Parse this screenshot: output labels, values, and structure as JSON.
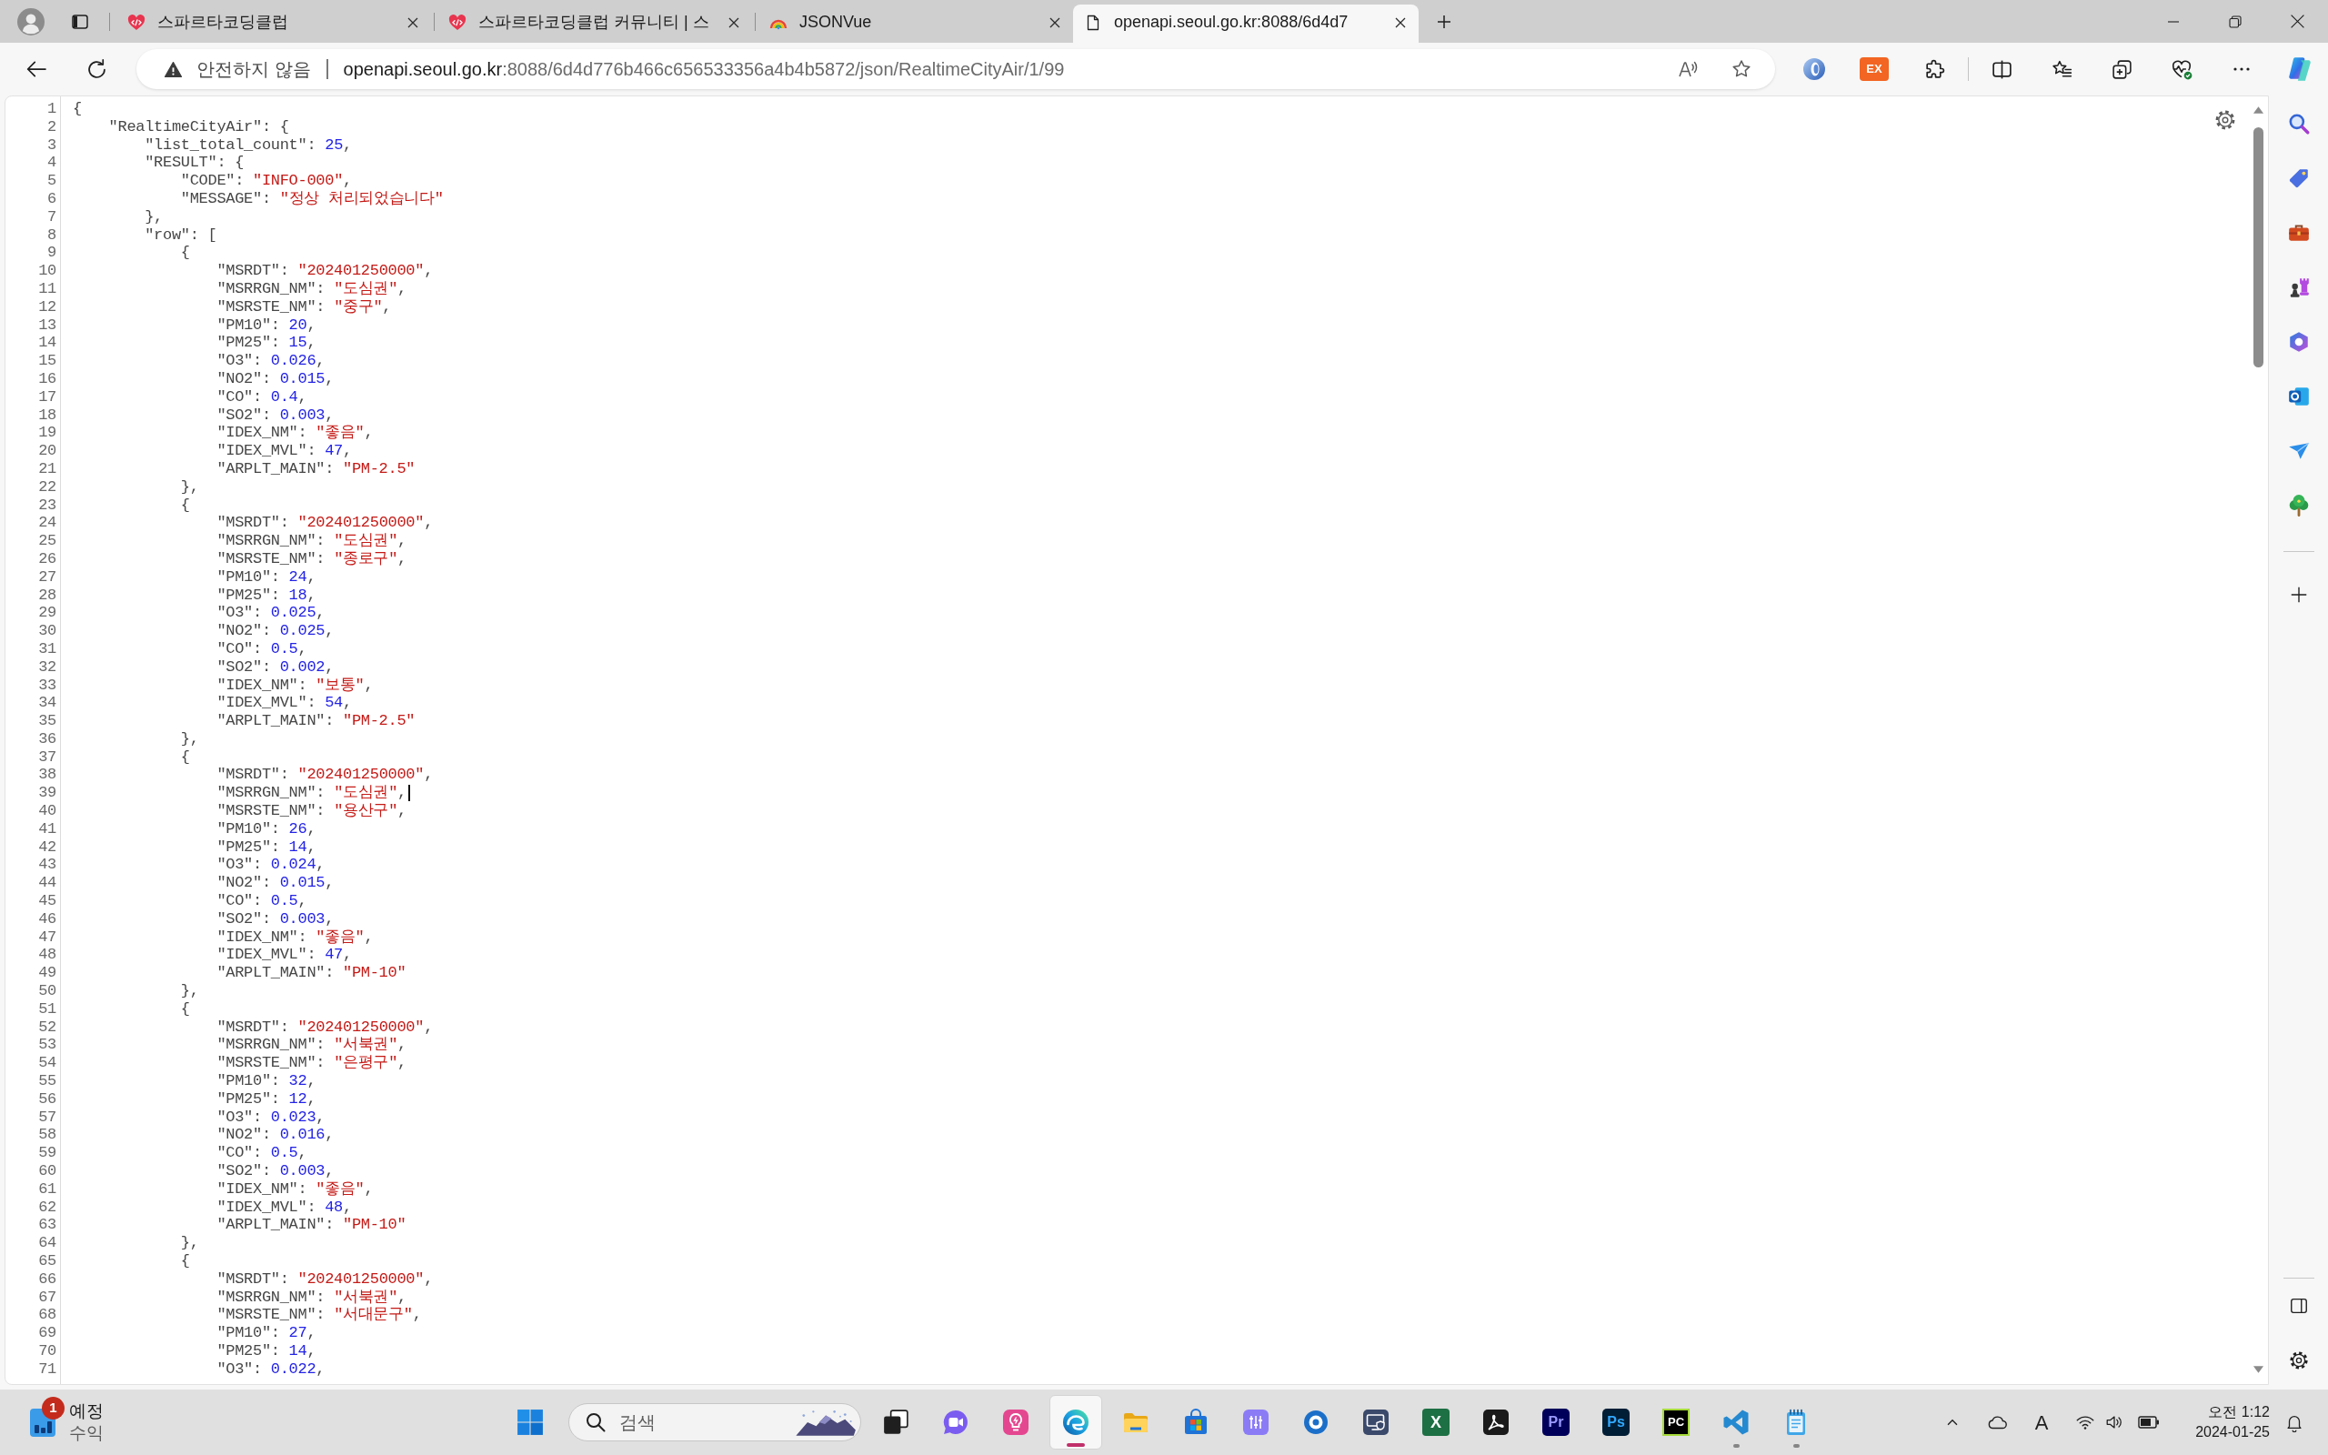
{
  "tabs": [
    {
      "kind": "site",
      "title": "스파르타코딩클럽",
      "selected": false
    },
    {
      "kind": "site",
      "title": "스파르타코딩클럽 커뮤니티 | 스",
      "selected": false
    },
    {
      "kind": "extension",
      "title": "JSONVue",
      "selected": false
    },
    {
      "kind": "page",
      "title": "openapi.seoul.go.kr:8088/6d4d7",
      "selected": true
    }
  ],
  "address_bar": {
    "security_label": "안전하지 않음",
    "url_host": "openapi.seoul.go.kr",
    "url_path": ":8088/6d4d776b466c656533356a4b4b5872/json/RealtimeCityAir/1/99"
  },
  "toolbar": {
    "extension_label": "EX"
  },
  "json_viewer": {
    "lines": [
      {
        "number": "1",
        "tokens": [
          {
            "kind": "plain",
            "text": "{"
          }
        ],
        "children": [
          {
            "number": "2",
            "tokens": [
              {
                "kind": "plain",
                "text": "\"RealtimeCityAir\": {"
              }
            ],
            "children": [
              {
                "number": "3",
                "tokens": [
                  {
                    "kind": "plain",
                    "text": "\"list_total_count\": "
                  },
                  {
                    "kind": "number",
                    "text": "25"
                  },
                  {
                    "kind": "plain",
                    "text": ","
                  }
                ]
              },
              {
                "number": "4",
                "tokens": [
                  {
                    "kind": "plain",
                    "text": "\"RESULT\": {"
                  }
                ],
                "children": [
                  {
                    "number": "5",
                    "tokens": [
                      {
                        "kind": "plain",
                        "text": "\"CODE\": "
                      },
                      {
                        "kind": "string",
                        "text": "\"INFO-000\""
                      },
                      {
                        "kind": "plain",
                        "text": ","
                      }
                    ]
                  },
                  {
                    "number": "6",
                    "tokens": [
                      {
                        "kind": "plain",
                        "text": "\"MESSAGE\": "
                      },
                      {
                        "kind": "string",
                        "text": "\"정상 처리되었습니다\""
                      }
                    ]
                  }
                ]
              },
              {
                "number": "7",
                "tokens": [
                  {
                    "kind": "plain",
                    "text": "},"
                  }
                ]
              },
              {
                "number": "8",
                "tokens": [
                  {
                    "kind": "plain",
                    "text": "\"row\": ["
                  }
                ],
                "children": [
                  {
                    "number": "9",
                    "tokens": [
                      {
                        "kind": "plain",
                        "text": "{"
                      }
                    ],
                    "children": [
                      {
                        "number": "10",
                        "tokens": [
                          {
                            "kind": "plain",
                            "text": "\"MSRDT\": "
                          },
                          {
                            "kind": "string",
                            "text": "\"202401250000\""
                          },
                          {
                            "kind": "plain",
                            "text": ","
                          }
                        ]
                      },
                      {
                        "number": "11",
                        "tokens": [
                          {
                            "kind": "plain",
                            "text": "\"MSRRGN_NM\": "
                          },
                          {
                            "kind": "string",
                            "text": "\"도심권\""
                          },
                          {
                            "kind": "plain",
                            "text": ","
                          }
                        ]
                      },
                      {
                        "number": "12",
                        "tokens": [
                          {
                            "kind": "plain",
                            "text": "\"MSRSTE_NM\": "
                          },
                          {
                            "kind": "string",
                            "text": "\"중구\""
                          },
                          {
                            "kind": "plain",
                            "text": ","
                          }
                        ]
                      },
                      {
                        "number": "13",
                        "tokens": [
                          {
                            "kind": "plain",
                            "text": "\"PM10\": "
                          },
                          {
                            "kind": "number",
                            "text": "20"
                          },
                          {
                            "kind": "plain",
                            "text": ","
                          }
                        ]
                      },
                      {
                        "number": "14",
                        "tokens": [
                          {
                            "kind": "plain",
                            "text": "\"PM25\": "
                          },
                          {
                            "kind": "number",
                            "text": "15"
                          },
                          {
                            "kind": "plain",
                            "text": ","
                          }
                        ]
                      },
                      {
                        "number": "15",
                        "tokens": [
                          {
                            "kind": "plain",
                            "text": "\"O3\": "
                          },
                          {
                            "kind": "number",
                            "text": "0.026"
                          },
                          {
                            "kind": "plain",
                            "text": ","
                          }
                        ]
                      },
                      {
                        "number": "16",
                        "tokens": [
                          {
                            "kind": "plain",
                            "text": "\"NO2\": "
                          },
                          {
                            "kind": "number",
                            "text": "0.015"
                          },
                          {
                            "kind": "plain",
                            "text": ","
                          }
                        ]
                      },
                      {
                        "number": "17",
                        "tokens": [
                          {
                            "kind": "plain",
                            "text": "\"CO\": "
                          },
                          {
                            "kind": "number",
                            "text": "0.4"
                          },
                          {
                            "kind": "plain",
                            "text": ","
                          }
                        ]
                      },
                      {
                        "number": "18",
                        "tokens": [
                          {
                            "kind": "plain",
                            "text": "\"SO2\": "
                          },
                          {
                            "kind": "number",
                            "text": "0.003"
                          },
                          {
                            "kind": "plain",
                            "text": ","
                          }
                        ]
                      },
                      {
                        "number": "19",
                        "tokens": [
                          {
                            "kind": "plain",
                            "text": "\"IDEX_NM\": "
                          },
                          {
                            "kind": "string",
                            "text": "\"좋음\""
                          },
                          {
                            "kind": "plain",
                            "text": ","
                          }
                        ]
                      },
                      {
                        "number": "20",
                        "tokens": [
                          {
                            "kind": "plain",
                            "text": "\"IDEX_MVL\": "
                          },
                          {
                            "kind": "number",
                            "text": "47"
                          },
                          {
                            "kind": "plain",
                            "text": ","
                          }
                        ]
                      },
                      {
                        "number": "21",
                        "tokens": [
                          {
                            "kind": "plain",
                            "text": "\"ARPLT_MAIN\": "
                          },
                          {
                            "kind": "string",
                            "text": "\"PM-2.5\""
                          }
                        ]
                      }
                    ]
                  },
                  {
                    "number": "22",
                    "tokens": [
                      {
                        "kind": "plain",
                        "text": "},"
                      }
                    ]
                  },
                  {
                    "number": "23",
                    "tokens": [
                      {
                        "kind": "plain",
                        "text": "{"
                      }
                    ],
                    "children": [
                      {
                        "number": "24",
                        "tokens": [
                          {
                            "kind": "plain",
                            "text": "\"MSRDT\": "
                          },
                          {
                            "kind": "string",
                            "text": "\"202401250000\""
                          },
                          {
                            "kind": "plain",
                            "text": ","
                          }
                        ]
                      },
                      {
                        "number": "25",
                        "tokens": [
                          {
                            "kind": "plain",
                            "text": "\"MSRRGN_NM\": "
                          },
                          {
                            "kind": "string",
                            "text": "\"도심권\""
                          },
                          {
                            "kind": "plain",
                            "text": ","
                          }
                        ]
                      },
                      {
                        "number": "26",
                        "tokens": [
                          {
                            "kind": "plain",
                            "text": "\"MSRSTE_NM\": "
                          },
                          {
                            "kind": "string",
                            "text": "\"종로구\""
                          },
                          {
                            "kind": "plain",
                            "text": ","
                          }
                        ]
                      },
                      {
                        "number": "27",
                        "tokens": [
                          {
                            "kind": "plain",
                            "text": "\"PM10\": "
                          },
                          {
                            "kind": "number",
                            "text": "24"
                          },
                          {
                            "kind": "plain",
                            "text": ","
                          }
                        ]
                      },
                      {
                        "number": "28",
                        "tokens": [
                          {
                            "kind": "plain",
                            "text": "\"PM25\": "
                          },
                          {
                            "kind": "number",
                            "text": "18"
                          },
                          {
                            "kind": "plain",
                            "text": ","
                          }
                        ]
                      },
                      {
                        "number": "29",
                        "tokens": [
                          {
                            "kind": "plain",
                            "text": "\"O3\": "
                          },
                          {
                            "kind": "number",
                            "text": "0.025"
                          },
                          {
                            "kind": "plain",
                            "text": ","
                          }
                        ]
                      },
                      {
                        "number": "30",
                        "tokens": [
                          {
                            "kind": "plain",
                            "text": "\"NO2\": "
                          },
                          {
                            "kind": "number",
                            "text": "0.025"
                          },
                          {
                            "kind": "plain",
                            "text": ","
                          }
                        ]
                      },
                      {
                        "number": "31",
                        "tokens": [
                          {
                            "kind": "plain",
                            "text": "\"CO\": "
                          },
                          {
                            "kind": "number",
                            "text": "0.5"
                          },
                          {
                            "kind": "plain",
                            "text": ","
                          }
                        ]
                      },
                      {
                        "number": "32",
                        "tokens": [
                          {
                            "kind": "plain",
                            "text": "\"SO2\": "
                          },
                          {
                            "kind": "number",
                            "text": "0.002"
                          },
                          {
                            "kind": "plain",
                            "text": ","
                          }
                        ]
                      },
                      {
                        "number": "33",
                        "tokens": [
                          {
                            "kind": "plain",
                            "text": "\"IDEX_NM\": "
                          },
                          {
                            "kind": "string",
                            "text": "\"보통\""
                          },
                          {
                            "kind": "plain",
                            "text": ","
                          }
                        ]
                      },
                      {
                        "number": "34",
                        "tokens": [
                          {
                            "kind": "plain",
                            "text": "\"IDEX_MVL\": "
                          },
                          {
                            "kind": "number",
                            "text": "54"
                          },
                          {
                            "kind": "plain",
                            "text": ","
                          }
                        ]
                      },
                      {
                        "number": "35",
                        "tokens": [
                          {
                            "kind": "plain",
                            "text": "\"ARPLT_MAIN\": "
                          },
                          {
                            "kind": "string",
                            "text": "\"PM-2.5\""
                          }
                        ]
                      }
                    ]
                  },
                  {
                    "number": "36",
                    "tokens": [
                      {
                        "kind": "plain",
                        "text": "},"
                      }
                    ]
                  },
                  {
                    "number": "37",
                    "tokens": [
                      {
                        "kind": "plain",
                        "text": "{"
                      }
                    ],
                    "children": [
                      {
                        "number": "38",
                        "tokens": [
                          {
                            "kind": "plain",
                            "text": "\"MSRDT\": "
                          },
                          {
                            "kind": "string",
                            "text": "\"202401250000\""
                          },
                          {
                            "kind": "plain",
                            "text": ","
                          }
                        ]
                      },
                      {
                        "number": "39",
                        "caret": true,
                        "tokens": [
                          {
                            "kind": "plain",
                            "text": "\"MSRRGN_NM\": "
                          },
                          {
                            "kind": "string",
                            "text": "\"도심권\""
                          },
                          {
                            "kind": "plain",
                            "text": ","
                          }
                        ]
                      },
                      {
                        "number": "40",
                        "tokens": [
                          {
                            "kind": "plain",
                            "text": "\"MSRSTE_NM\": "
                          },
                          {
                            "kind": "string",
                            "text": "\"용산구\""
                          },
                          {
                            "kind": "plain",
                            "text": ","
                          }
                        ]
                      },
                      {
                        "number": "41",
                        "tokens": [
                          {
                            "kind": "plain",
                            "text": "\"PM10\": "
                          },
                          {
                            "kind": "number",
                            "text": "26"
                          },
                          {
                            "kind": "plain",
                            "text": ","
                          }
                        ]
                      },
                      {
                        "number": "42",
                        "tokens": [
                          {
                            "kind": "plain",
                            "text": "\"PM25\": "
                          },
                          {
                            "kind": "number",
                            "text": "14"
                          },
                          {
                            "kind": "plain",
                            "text": ","
                          }
                        ]
                      },
                      {
                        "number": "43",
                        "tokens": [
                          {
                            "kind": "plain",
                            "text": "\"O3\": "
                          },
                          {
                            "kind": "number",
                            "text": "0.024"
                          },
                          {
                            "kind": "plain",
                            "text": ","
                          }
                        ]
                      },
                      {
                        "number": "44",
                        "tokens": [
                          {
                            "kind": "plain",
                            "text": "\"NO2\": "
                          },
                          {
                            "kind": "number",
                            "text": "0.015"
                          },
                          {
                            "kind": "plain",
                            "text": ","
                          }
                        ]
                      },
                      {
                        "number": "45",
                        "tokens": [
                          {
                            "kind": "plain",
                            "text": "\"CO\": "
                          },
                          {
                            "kind": "number",
                            "text": "0.5"
                          },
                          {
                            "kind": "plain",
                            "text": ","
                          }
                        ]
                      },
                      {
                        "number": "46",
                        "tokens": [
                          {
                            "kind": "plain",
                            "text": "\"SO2\": "
                          },
                          {
                            "kind": "number",
                            "text": "0.003"
                          },
                          {
                            "kind": "plain",
                            "text": ","
                          }
                        ]
                      },
                      {
                        "number": "47",
                        "tokens": [
                          {
                            "kind": "plain",
                            "text": "\"IDEX_NM\": "
                          },
                          {
                            "kind": "string",
                            "text": "\"좋음\""
                          },
                          {
                            "kind": "plain",
                            "text": ","
                          }
                        ]
                      },
                      {
                        "number": "48",
                        "tokens": [
                          {
                            "kind": "plain",
                            "text": "\"IDEX_MVL\": "
                          },
                          {
                            "kind": "number",
                            "text": "47"
                          },
                          {
                            "kind": "plain",
                            "text": ","
                          }
                        ]
                      },
                      {
                        "number": "49",
                        "tokens": [
                          {
                            "kind": "plain",
                            "text": "\"ARPLT_MAIN\": "
                          },
                          {
                            "kind": "string",
                            "text": "\"PM-10\""
                          }
                        ]
                      }
                    ]
                  },
                  {
                    "number": "50",
                    "tokens": [
                      {
                        "kind": "plain",
                        "text": "},"
                      }
                    ]
                  },
                  {
                    "number": "51",
                    "tokens": [
                      {
                        "kind": "plain",
                        "text": "{"
                      }
                    ],
                    "children": [
                      {
                        "number": "52",
                        "tokens": [
                          {
                            "kind": "plain",
                            "text": "\"MSRDT\": "
                          },
                          {
                            "kind": "string",
                            "text": "\"202401250000\""
                          },
                          {
                            "kind": "plain",
                            "text": ","
                          }
                        ]
                      },
                      {
                        "number": "53",
                        "tokens": [
                          {
                            "kind": "plain",
                            "text": "\"MSRRGN_NM\": "
                          },
                          {
                            "kind": "string",
                            "text": "\"서북권\""
                          },
                          {
                            "kind": "plain",
                            "text": ","
                          }
                        ]
                      },
                      {
                        "number": "54",
                        "tokens": [
                          {
                            "kind": "plain",
                            "text": "\"MSRSTE_NM\": "
                          },
                          {
                            "kind": "string",
                            "text": "\"은평구\""
                          },
                          {
                            "kind": "plain",
                            "text": ","
                          }
                        ]
                      },
                      {
                        "number": "55",
                        "tokens": [
                          {
                            "kind": "plain",
                            "text": "\"PM10\": "
                          },
                          {
                            "kind": "number",
                            "text": "32"
                          },
                          {
                            "kind": "plain",
                            "text": ","
                          }
                        ]
                      },
                      {
                        "number": "56",
                        "tokens": [
                          {
                            "kind": "plain",
                            "text": "\"PM25\": "
                          },
                          {
                            "kind": "number",
                            "text": "12"
                          },
                          {
                            "kind": "plain",
                            "text": ","
                          }
                        ]
                      },
                      {
                        "number": "57",
                        "tokens": [
                          {
                            "kind": "plain",
                            "text": "\"O3\": "
                          },
                          {
                            "kind": "number",
                            "text": "0.023"
                          },
                          {
                            "kind": "plain",
                            "text": ","
                          }
                        ]
                      },
                      {
                        "number": "58",
                        "tokens": [
                          {
                            "kind": "plain",
                            "text": "\"NO2\": "
                          },
                          {
                            "kind": "number",
                            "text": "0.016"
                          },
                          {
                            "kind": "plain",
                            "text": ","
                          }
                        ]
                      },
                      {
                        "number": "59",
                        "tokens": [
                          {
                            "kind": "plain",
                            "text": "\"CO\": "
                          },
                          {
                            "kind": "number",
                            "text": "0.5"
                          },
                          {
                            "kind": "plain",
                            "text": ","
                          }
                        ]
                      },
                      {
                        "number": "60",
                        "tokens": [
                          {
                            "kind": "plain",
                            "text": "\"SO2\": "
                          },
                          {
                            "kind": "number",
                            "text": "0.003"
                          },
                          {
                            "kind": "plain",
                            "text": ","
                          }
                        ]
                      },
                      {
                        "number": "61",
                        "tokens": [
                          {
                            "kind": "plain",
                            "text": "\"IDEX_NM\": "
                          },
                          {
                            "kind": "string",
                            "text": "\"좋음\""
                          },
                          {
                            "kind": "plain",
                            "text": ","
                          }
                        ]
                      },
                      {
                        "number": "62",
                        "tokens": [
                          {
                            "kind": "plain",
                            "text": "\"IDEX_MVL\": "
                          },
                          {
                            "kind": "number",
                            "text": "48"
                          },
                          {
                            "kind": "plain",
                            "text": ","
                          }
                        ]
                      },
                      {
                        "number": "63",
                        "tokens": [
                          {
                            "kind": "plain",
                            "text": "\"ARPLT_MAIN\": "
                          },
                          {
                            "kind": "string",
                            "text": "\"PM-10\""
                          }
                        ]
                      }
                    ]
                  },
                  {
                    "number": "64",
                    "tokens": [
                      {
                        "kind": "plain",
                        "text": "},"
                      }
                    ]
                  },
                  {
                    "number": "65",
                    "tokens": [
                      {
                        "kind": "plain",
                        "text": "{"
                      }
                    ],
                    "children": [
                      {
                        "number": "66",
                        "tokens": [
                          {
                            "kind": "plain",
                            "text": "\"MSRDT\": "
                          },
                          {
                            "kind": "string",
                            "text": "\"202401250000\""
                          },
                          {
                            "kind": "plain",
                            "text": ","
                          }
                        ]
                      },
                      {
                        "number": "67",
                        "tokens": [
                          {
                            "kind": "plain",
                            "text": "\"MSRRGN_NM\": "
                          },
                          {
                            "kind": "string",
                            "text": "\"서북권\""
                          },
                          {
                            "kind": "plain",
                            "text": ","
                          }
                        ]
                      },
                      {
                        "number": "68",
                        "tokens": [
                          {
                            "kind": "plain",
                            "text": "\"MSRSTE_NM\": "
                          },
                          {
                            "kind": "string",
                            "text": "\"서대문구\""
                          },
                          {
                            "kind": "plain",
                            "text": ","
                          }
                        ]
                      },
                      {
                        "number": "69",
                        "tokens": [
                          {
                            "kind": "plain",
                            "text": "\"PM10\": "
                          },
                          {
                            "kind": "number",
                            "text": "27"
                          },
                          {
                            "kind": "plain",
                            "text": ","
                          }
                        ]
                      },
                      {
                        "number": "70",
                        "tokens": [
                          {
                            "kind": "plain",
                            "text": "\"PM25\": "
                          },
                          {
                            "kind": "number",
                            "text": "14"
                          },
                          {
                            "kind": "plain",
                            "text": ","
                          }
                        ]
                      },
                      {
                        "number": "71",
                        "tokens": [
                          {
                            "kind": "plain",
                            "text": "\"O3\": "
                          },
                          {
                            "kind": "number",
                            "text": "0.022"
                          },
                          {
                            "kind": "plain",
                            "text": ","
                          }
                        ]
                      }
                    ]
                  }
                ]
              }
            ]
          }
        ]
      }
    ]
  },
  "taskbar": {
    "widget": {
      "badge": "1",
      "title": "예정",
      "subtitle": "수익"
    },
    "search": {
      "placeholder": "검색"
    },
    "apps": [
      {
        "kind": "task-view",
        "running": false,
        "focused": false
      },
      {
        "kind": "video-chat",
        "running": false,
        "focused": false
      },
      {
        "kind": "lightbulb",
        "running": false,
        "focused": false
      },
      {
        "kind": "swirl",
        "running": true,
        "focused": true
      },
      {
        "kind": "folder",
        "running": false,
        "focused": false
      },
      {
        "kind": "bag",
        "running": false,
        "focused": false
      },
      {
        "kind": "sliders",
        "running": false,
        "focused": false
      },
      {
        "kind": "ring",
        "running": false,
        "focused": false
      },
      {
        "kind": "monitor-shield",
        "running": false,
        "focused": false
      },
      {
        "kind": "sheet-tile",
        "label": "X",
        "running": false,
        "focused": false
      },
      {
        "kind": "loop-tile",
        "running": false,
        "focused": false
      },
      {
        "kind": "video-tile",
        "label": "Pr",
        "running": false,
        "focused": false
      },
      {
        "kind": "photo-tile",
        "label": "Ps",
        "running": false,
        "focused": false
      },
      {
        "kind": "ide-tile",
        "label": "PC",
        "running": false,
        "focused": false
      },
      {
        "kind": "ribbon",
        "running": true,
        "focused": false
      },
      {
        "kind": "notepad",
        "running": true,
        "focused": false
      }
    ],
    "input_indicator": "A",
    "clock": {
      "time": "오전 1:12",
      "date": "2024-01-25"
    }
  }
}
